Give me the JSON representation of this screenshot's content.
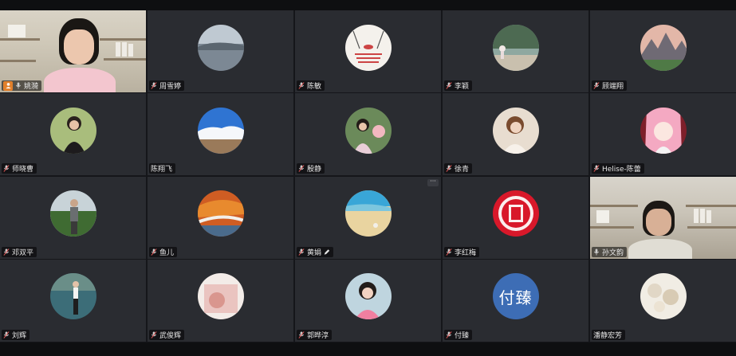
{
  "participants": [
    {
      "name": "姚漪",
      "tile": "video-a",
      "host": true,
      "avatar": "video"
    },
    {
      "name": "周雪婷",
      "avatar": "lake-photo"
    },
    {
      "name": "陈敏",
      "avatar": "meme-image"
    },
    {
      "name": "李颖",
      "avatar": "garden-photo"
    },
    {
      "name": "顾端翔",
      "avatar": "mountain-photo"
    },
    {
      "name": "师晓曹",
      "avatar": "woman-portrait"
    },
    {
      "name": "陈翔飞",
      "avatar": "snow-mountain-photo",
      "no_mic": true
    },
    {
      "name": "殷静",
      "avatar": "girl-photo"
    },
    {
      "name": "徐青",
      "avatar": "illustration-portrait"
    },
    {
      "name": "Helise-陈蕾",
      "avatar": "anime-portrait"
    },
    {
      "name": "邓双平",
      "avatar": "man-field-photo"
    },
    {
      "name": "鱼儿",
      "avatar": "autumn-bridge-photo"
    },
    {
      "name": "黄娟",
      "avatar": "beach-photo",
      "edit": true,
      "more": "···"
    },
    {
      "name": "李红梅",
      "avatar": "red-papercut"
    },
    {
      "name": "孙文韵",
      "tile": "video-b",
      "avatar": "video",
      "mic_muted": false
    },
    {
      "name": "刘辉",
      "avatar": "woman-lake-photo"
    },
    {
      "name": "武俊辉",
      "avatar": "pink-card"
    },
    {
      "name": "郭晔淳",
      "avatar": "woman-pink-photo"
    },
    {
      "name": "付臻",
      "avatar": "text",
      "avatar_text": "付臻",
      "avatar_color": "#3d6db5"
    },
    {
      "name": "潘静宏芳",
      "avatar": "shells-photo",
      "no_mic": true
    }
  ],
  "colors": {
    "tile_bg": "#2a2c31",
    "host_badge": "#e2802b",
    "mic": "#cfcfcf"
  }
}
